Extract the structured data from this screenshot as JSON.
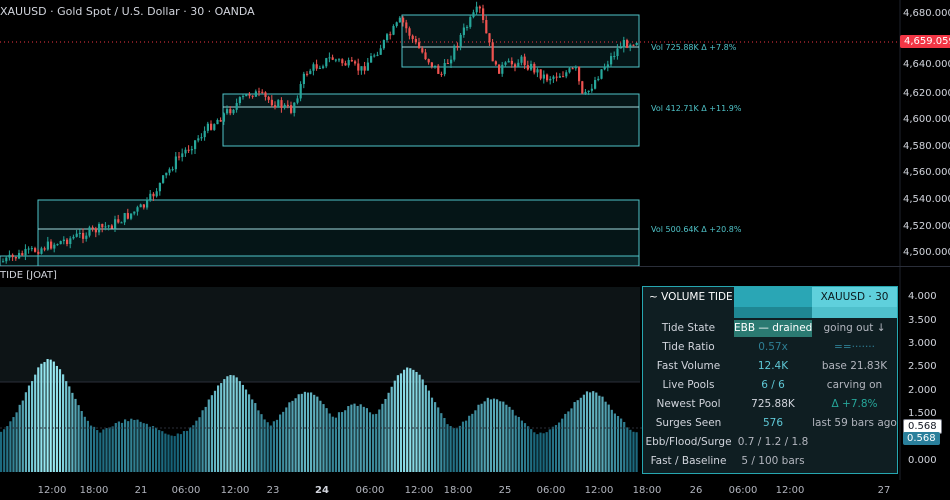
{
  "chart": {
    "title": "XAUUSD · Gold Spot / U.S. Dollar · 30 · OANDA",
    "indicator_title": "TIDE [JOAT]",
    "current_price": "4,659.059",
    "price_levels": [
      "4,680.000",
      "4,660.000",
      "4,640.000",
      "4,620.000",
      "4,600.000",
      "4,580.000",
      "4,560.000",
      "4,540.000",
      "4,520.000",
      "4,500.000"
    ],
    "osc_levels": [
      "4.000",
      "3.500",
      "3.000",
      "2.500",
      "2.000",
      "1.500",
      "1.000",
      "0.500",
      "0.000"
    ],
    "osc_value": "0.568",
    "time_labels": [
      "12:00",
      "18:00",
      "21",
      "06:00",
      "12:00",
      "23",
      "24",
      "06:00",
      "12:00",
      "18:00",
      "25",
      "06:00",
      "12:00",
      "18:00",
      "26",
      "06:00",
      "12:00",
      "27"
    ],
    "pools": [
      {
        "label": "Vol 725.88K  Δ +7.8%"
      },
      {
        "label": "Vol 412.71K  Δ +11.9%"
      },
      {
        "label": "Vol 500.64K  Δ +20.8%"
      }
    ],
    "colors": {
      "up": "#26a69a",
      "down": "#ef5350",
      "accent": "#26a6b0",
      "price_badge": "#f23645"
    }
  },
  "panel": {
    "header": {
      "title": "~ VOLUME TIDE",
      "symbol": "XAUUSD · 30"
    },
    "rows": [
      {
        "label": "Tide State",
        "value": "EBB — drained",
        "note": "going out ↓"
      },
      {
        "label": "Tide Ratio",
        "value": "0.57x",
        "note": "==·······"
      },
      {
        "label": "Fast Volume",
        "value": "12.4K",
        "note": "base 21.83K"
      },
      {
        "label": "Live Pools",
        "value": "6 / 6",
        "note": "carving on"
      },
      {
        "label": "Newest Pool",
        "value": "725.88K",
        "note": "Δ +7.8%"
      },
      {
        "label": "Surges Seen",
        "value": "576",
        "note": "last 59 bars ago"
      },
      {
        "label": "Ebb/Flood/Surge",
        "value": "0.7 / 1.2 / 1.8",
        "note": ""
      },
      {
        "label": "Fast / Baseline",
        "value": "5 / 100 bars",
        "note": ""
      }
    ]
  }
}
